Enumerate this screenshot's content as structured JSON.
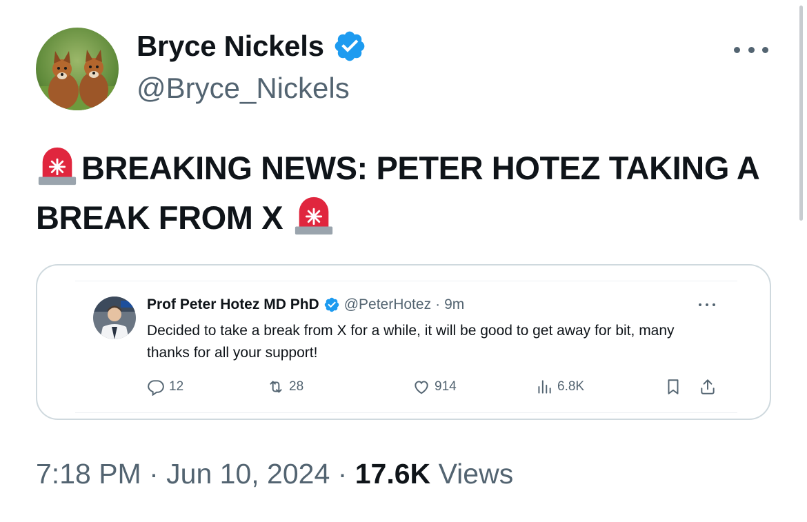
{
  "tweet": {
    "author_name": "Bryce Nickels",
    "author_handle": "@Bryce_Nickels",
    "text": "BREAKING NEWS: PETER HOTEZ TAKING A BREAK FROM X",
    "lead_emoji": "police-light-icon",
    "trail_emoji": "police-light-icon",
    "time": "7:18 PM",
    "date": "Jun 10, 2024",
    "separator": "·",
    "views_count": "17.6K",
    "views_label": "Views"
  },
  "quoted": {
    "author_name": "Prof Peter Hotez MD PhD",
    "author_handle": "@PeterHotez",
    "separator": "·",
    "time": "9m",
    "text": "Decided to take a break from X for a while, it will be good to get away for bit, many thanks for all your support!",
    "replies": "12",
    "retweets": "28",
    "likes": "914",
    "views": "6.8K"
  },
  "colors": {
    "text_primary": "#0f1419",
    "text_secondary": "#536471",
    "verified_blue": "#1d9bf0",
    "border": "#cfd9de",
    "siren_red": "#e0263e"
  }
}
